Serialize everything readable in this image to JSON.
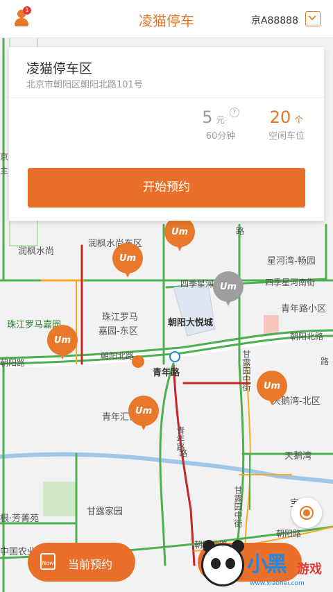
{
  "header": {
    "title": "凌猫停车",
    "badge_count": "1",
    "plate": "京A88888"
  },
  "parking": {
    "name": "凌猫停车区",
    "address": "北京市朝阳区朝阳北路101号",
    "price_value": "5",
    "price_unit": "元",
    "price_help": "?",
    "price_period": "60分钟",
    "free_value": "20",
    "free_unit": "个",
    "free_label": "空闲车位",
    "reserve_label": "开始预约"
  },
  "map": {
    "labels": [
      "润枫水尚东区",
      "润枫水尚",
      "珠江罗马嘉园",
      "珠江罗马",
      "嘉园-东区",
      "朝阳大悦城",
      "星河湾-畅园",
      "四季星河南街",
      "四季星河",
      "青年路小区",
      "朝阳北路",
      "朝阳北路",
      "朝阳北路",
      "青年路",
      "甘露园中街",
      "天鹅湾-北区",
      "青年汇佳园",
      "青年路",
      "天鹅湾",
      "宝成",
      "甘露家园",
      "根·芳菁苑",
      "甘露园中街",
      "朝阳路",
      "朝阳路",
      "中国农业",
      "路",
      "路",
      "路",
      "主",
      "京"
    ],
    "pin_logo": "Um"
  },
  "bottom": {
    "current_label": "当前预约",
    "current_icon_text": "Now"
  },
  "watermark": {
    "brand": "小黑",
    "brand2": "游戏",
    "url": "www.xiaohei.com"
  },
  "colors": {
    "accent": "#e8702a",
    "road_green": "#4caf50",
    "road_red": "#c62828",
    "road_yellow": "#f9a825"
  }
}
